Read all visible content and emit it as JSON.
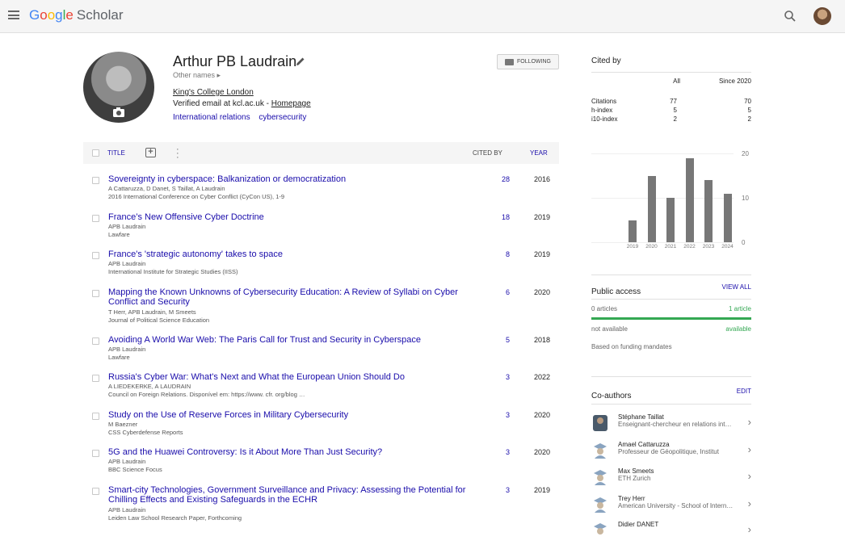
{
  "header": {
    "logo": {
      "g1": "G",
      "g2": "o",
      "g3": "o",
      "g4": "g",
      "g5": "l",
      "g6": "e",
      "rest": "Scholar"
    }
  },
  "profile": {
    "name": "Arthur PB Laudrain",
    "other_names": "Other names ▸",
    "affiliation": "King's College London",
    "email_prefix": "Verified email at kcl.ac.uk - ",
    "homepage": "Homepage",
    "interests": [
      "International relations",
      "cybersecurity"
    ],
    "follow_label": "FOLLOWING"
  },
  "table": {
    "col_title": "TITLE",
    "col_cited": "CITED BY",
    "col_year": "YEAR",
    "rows": [
      {
        "title": "Sovereignty in cyberspace: Balkanization or democratization",
        "authors": "A Cattaruzza, D Danet, S Taillat, A Laudrain",
        "venue": "2016 International Conference on Cyber Conflict (CyCon US), 1-9",
        "cites": "28",
        "year": "2016"
      },
      {
        "title": "France’s New Offensive Cyber Doctrine",
        "authors": "APB Laudrain",
        "venue": "Lawfare",
        "cites": "18",
        "year": "2019"
      },
      {
        "title": "France's 'strategic autonomy' takes to space",
        "authors": "APB Laudrain",
        "venue": "International Institute for Strategic Studies (IISS)",
        "cites": "8",
        "year": "2019"
      },
      {
        "title": "Mapping the Known Unknowns of Cybersecurity Education: A Review of Syllabi on Cyber Conflict and Security",
        "authors": "T Herr, APB Laudrain, M Smeets",
        "venue": "Journal of Political Science Education",
        "cites": "6",
        "year": "2020"
      },
      {
        "title": "Avoiding A World War Web: The Paris Call for Trust and Security in Cyberspace",
        "authors": "APB Laudrain",
        "venue": "Lawfare",
        "cites": "5",
        "year": "2018"
      },
      {
        "title": "Russia's Cyber War: What's Next and What the European Union Should Do",
        "authors": "A LIEDEKERKE, A LAUDRAIN",
        "venue": "Council on Foreign Relations. Disponível em: https://www. cfr. org/blog …",
        "cites": "3",
        "year": "2022"
      },
      {
        "title": "Study on the Use of Reserve Forces in Military Cybersecurity",
        "authors": "M Baezner",
        "venue": "CSS Cyberdefense Reports",
        "cites": "3",
        "year": "2020"
      },
      {
        "title": "5G and the Huawei Controversy: Is it About More Than Just Security?",
        "authors": "APB Laudrain",
        "venue": "BBC Science Focus",
        "cites": "3",
        "year": "2020"
      },
      {
        "title": "Smart-city Technologies, Government Surveillance and Privacy: Assessing the Potential for Chilling Effects and Existing Safeguards in the ECHR",
        "authors": "APB Laudrain",
        "venue": "Leiden Law School Research Paper, Forthcoming",
        "cites": "3",
        "year": "2019"
      }
    ]
  },
  "cited_by": {
    "title": "Cited by",
    "col_all": "All",
    "col_since": "Since 2020",
    "rows": [
      {
        "label": "Citations",
        "all": "77",
        "since": "70"
      },
      {
        "label": "h-index",
        "all": "5",
        "since": "5"
      },
      {
        "label": "i10-index",
        "all": "2",
        "since": "2"
      }
    ]
  },
  "chart_data": {
    "type": "bar",
    "categories": [
      "2019",
      "2020",
      "2021",
      "2022",
      "2023",
      "2024"
    ],
    "values": [
      5,
      15,
      10,
      19,
      14,
      11
    ],
    "yticks": [
      "20",
      "10",
      "0"
    ],
    "ylim": [
      0,
      20
    ]
  },
  "public_access": {
    "title": "Public access",
    "view_all": "VIEW ALL",
    "left1": "0 articles",
    "right1": "1 article",
    "left2": "not available",
    "right2": "available",
    "note": "Based on funding mandates"
  },
  "coauthors": {
    "title": "Co-authors",
    "edit": "EDIT",
    "items": [
      {
        "name": "Stéphane Taillat",
        "affiliation": "Enseignant-chercheur en relations internationales"
      },
      {
        "name": "Amael Cattaruzza",
        "affiliation": "Professeur de Géopolitique, Institut"
      },
      {
        "name": "Max Smeets",
        "affiliation": "ETH Zurich"
      },
      {
        "name": "Trey Herr",
        "affiliation": "American University - School of International Service"
      },
      {
        "name": "Didier DANET",
        "affiliation": ""
      }
    ]
  },
  "colors": {
    "link": "#1a0dab",
    "bar": "#777777",
    "green": "#34a853"
  }
}
